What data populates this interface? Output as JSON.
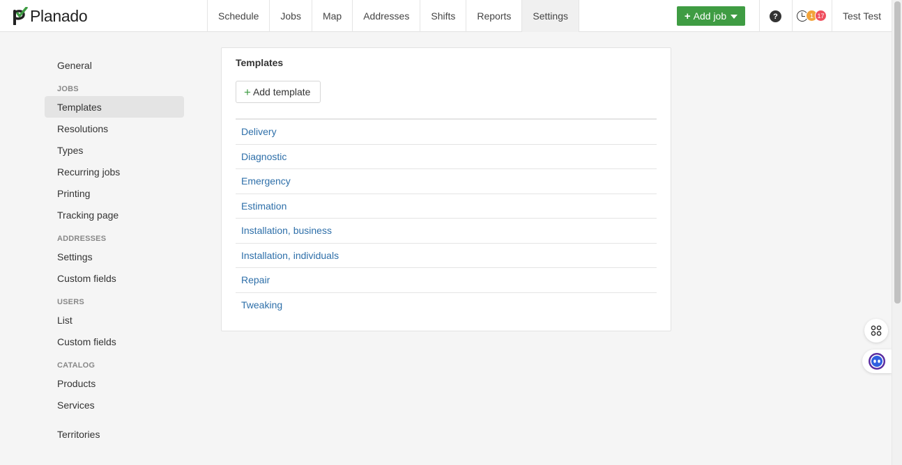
{
  "header": {
    "brand": "Planado",
    "nav": [
      {
        "label": "Schedule",
        "active": false
      },
      {
        "label": "Jobs",
        "active": false
      },
      {
        "label": "Map",
        "active": false
      },
      {
        "label": "Addresses",
        "active": false
      },
      {
        "label": "Shifts",
        "active": false
      },
      {
        "label": "Reports",
        "active": false
      },
      {
        "label": "Settings",
        "active": true
      }
    ],
    "add_job_label": "Add job",
    "help_label": "?",
    "badge_orange": "1",
    "badge_red": "17",
    "user_name": "Test Test"
  },
  "sidebar": {
    "general": "General",
    "jobs_heading": "JOBS",
    "jobs_items": [
      "Templates",
      "Resolutions",
      "Types",
      "Recurring jobs",
      "Printing",
      "Tracking page"
    ],
    "addresses_heading": "ADDRESSES",
    "addresses_items": [
      "Settings",
      "Custom fields"
    ],
    "users_heading": "USERS",
    "users_items": [
      "List",
      "Custom fields"
    ],
    "catalog_heading": "CATALOG",
    "catalog_items": [
      "Products",
      "Services"
    ],
    "territories": "Territories"
  },
  "main": {
    "title": "Templates",
    "add_template_label": "Add template",
    "templates": [
      "Delivery",
      "Diagnostic",
      "Emergency",
      "Estimation",
      "Installation, business",
      "Installation, individuals",
      "Repair",
      "Tweaking"
    ]
  },
  "colors": {
    "accent_green": "#3f9c43",
    "link_blue": "#2e6fa9",
    "badge_orange": "#f2a33a",
    "badge_red": "#ef4f5f"
  },
  "icons": {
    "help": "help-icon",
    "notifications": "clock-icon",
    "widget_grid": "grid-icon",
    "widget_chat": "chat-bot-icon"
  }
}
